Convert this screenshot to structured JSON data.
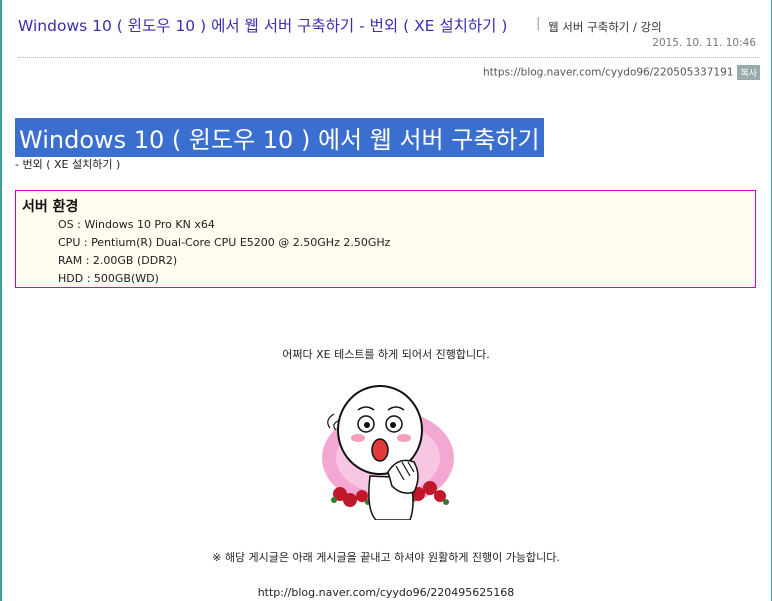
{
  "header": {
    "title": "Windows 10 ( 윈도우 10 ) 에서 웹 서버 구축하기 - 번외 ( XE 설치하기 )",
    "separator": "|",
    "category": "웹 서버 구축하기 / 강의",
    "date": "2015. 10. 11. 10:46"
  },
  "url_bar": {
    "url": "https://blog.naver.com/cyydo96/220505337191",
    "copy_label": "복사"
  },
  "post": {
    "heading": "Windows 10 ( 윈도우 10 ) 에서 웹 서버 구축하기",
    "subheading": "- 번외 ( XE 설치하기 )"
  },
  "server_env": {
    "title": "서버 환경",
    "specs": [
      "OS : Windows 10 Pro KN x64",
      "CPU : Pentium(R) Dual-Core CPU E5200 @ 2.50GHz 2.50GHz",
      "RAM : 2.00GB (DDR2)",
      "HDD : 500GB(WD)"
    ]
  },
  "body": {
    "intro": "어쩌다 XE 테스트를 하게 되어서 진행합니다.",
    "note": "※ 해당 게시글은 아래 게시글을 끝내고 하셔야 원활하게 진행이 가능합니다.",
    "link": "http://blog.naver.com/cyydo96/220495625168"
  },
  "colors": {
    "title_link": "#3a2fb0",
    "heading_highlight": "#3a6fd0",
    "box_border": "#d000c0",
    "box_background": "#fffbef",
    "frame": "#3aa0a0"
  },
  "icons": {
    "sticker": "shocked-face-sticker-icon"
  }
}
